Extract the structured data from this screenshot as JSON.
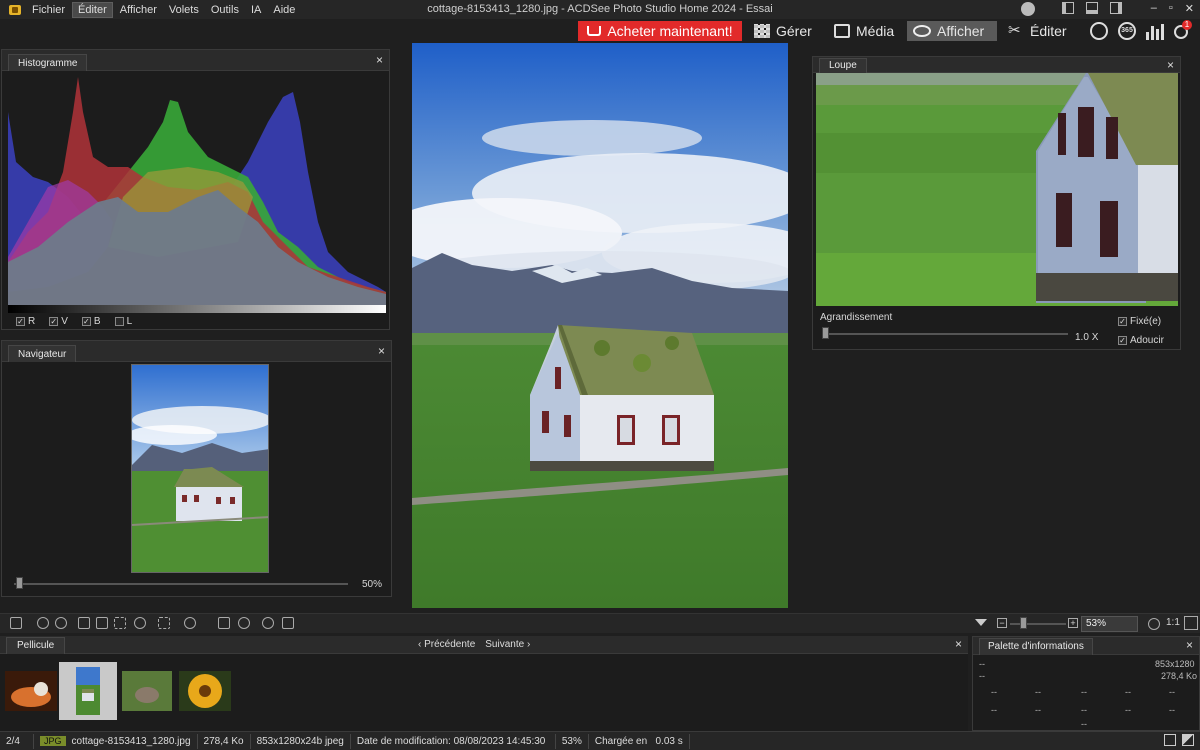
{
  "window": {
    "title": "cottage-8153413_1280.jpg - ACDSee Photo Studio Home 2024 - Essai",
    "controls": [
      "–",
      "▫",
      "✕"
    ]
  },
  "menu": [
    "Fichier",
    "Éditer",
    "Afficher",
    "Volets",
    "Outils",
    "IA",
    "Aide"
  ],
  "menu_active": "Éditer",
  "modes": {
    "buy": "Acheter maintenant!",
    "manage": "Gérer",
    "media": "Média",
    "view": "Afficher",
    "edit": "Éditer",
    "badge": "1",
    "icon365": "365"
  },
  "histogram": {
    "title": "Histogramme",
    "channels": [
      {
        "key": "R",
        "label": "R",
        "checked": true,
        "color": "#c0393d"
      },
      {
        "key": "V",
        "label": "V",
        "checked": true,
        "color": "#3db03a"
      },
      {
        "key": "B",
        "label": "B",
        "checked": true,
        "color": "#3b3fc0"
      },
      {
        "key": "L",
        "label": "L",
        "checked": false,
        "color": "#9aa0a8"
      }
    ],
    "check_mark": "✓"
  },
  "navigator": {
    "title": "Navigateur",
    "zoom": "50%"
  },
  "loupe": {
    "title": "Loupe",
    "magnification_label": "Agrandissement",
    "magnification_value": "1.0",
    "magnification_unit": "X",
    "fixed_label": "Fixé(e)",
    "smooth_label": "Adoucir"
  },
  "toolbar": {
    "zoom_value": "53%",
    "ratio": "1:1"
  },
  "filmstrip": {
    "title": "Pellicule",
    "prev": "Précédente",
    "next": "Suivante",
    "thumbnails": [
      "cat",
      "cottage",
      "mouse",
      "flower"
    ],
    "selected": "cottage"
  },
  "info_palette": {
    "title": "Palette d'informations",
    "dims": "853x1280",
    "size": "278,4 Ko",
    "dash": "--"
  },
  "status": {
    "position": "2/4",
    "format": "JPG",
    "filename": "cottage-8153413_1280.jpg",
    "filesize": "278,4 Ko",
    "dims": "853x1280x24b jpeg",
    "modified": "Date de modification: 08/08/2023 14:45:30",
    "zoom": "53%",
    "loaded": "Chargée en   0.03 s"
  },
  "close_glyph": "×"
}
